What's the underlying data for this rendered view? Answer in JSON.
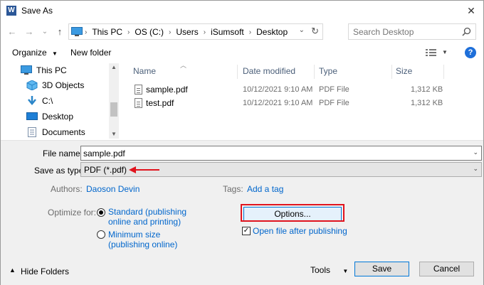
{
  "window": {
    "title": "Save As",
    "app_icon_letter": "W"
  },
  "nav_buttons": {
    "back": "←",
    "forward": "→",
    "recent": "⌄",
    "up": "↑"
  },
  "address": {
    "crumbs": [
      "This PC",
      "OS (C:)",
      "Users",
      "iSumsoft",
      "Desktop"
    ]
  },
  "search": {
    "placeholder": "Search Desktop"
  },
  "toolbar": {
    "organize": "Organize",
    "new_folder": "New folder"
  },
  "nav_pane": {
    "items": [
      {
        "label": "This PC",
        "icon": "computer-icon"
      },
      {
        "label": "3D Objects",
        "icon": "cube-icon"
      },
      {
        "label": "C:\\",
        "icon": "download-arrow-icon"
      },
      {
        "label": "Desktop",
        "icon": "desktop-icon"
      },
      {
        "label": "Documents",
        "icon": "documents-icon"
      }
    ]
  },
  "file_list": {
    "columns": [
      "Name",
      "Date modified",
      "Type",
      "Size"
    ],
    "rows": [
      {
        "name": "sample.pdf",
        "date": "10/12/2021 9:10 AM",
        "type": "PDF File",
        "size": "1,312 KB"
      },
      {
        "name": "test.pdf",
        "date": "10/12/2021 9:10 AM",
        "type": "PDF File",
        "size": "1,312 KB"
      }
    ]
  },
  "form": {
    "file_name_label": "File name:",
    "file_name_value": "sample.pdf",
    "save_type_label": "Save as type:",
    "save_type_value": "PDF (*.pdf)",
    "authors_label": "Authors:",
    "authors_value": "Daoson Devin",
    "tags_label": "Tags:",
    "tags_value": "Add a tag",
    "optimize_label": "Optimize for:",
    "opt_standard_line1": "Standard (publishing",
    "opt_standard_line2": "online and printing)",
    "opt_minimum_line1": "Minimum size",
    "opt_minimum_line2": "(publishing online)",
    "options_button": "Options...",
    "open_after_label": "Open file after publishing"
  },
  "footer": {
    "hide_folders": "Hide Folders",
    "tools": "Tools",
    "save": "Save",
    "cancel": "Cancel"
  },
  "colors": {
    "accent": "#0078d7",
    "link": "#0066cc",
    "highlight": "#e0141e"
  }
}
